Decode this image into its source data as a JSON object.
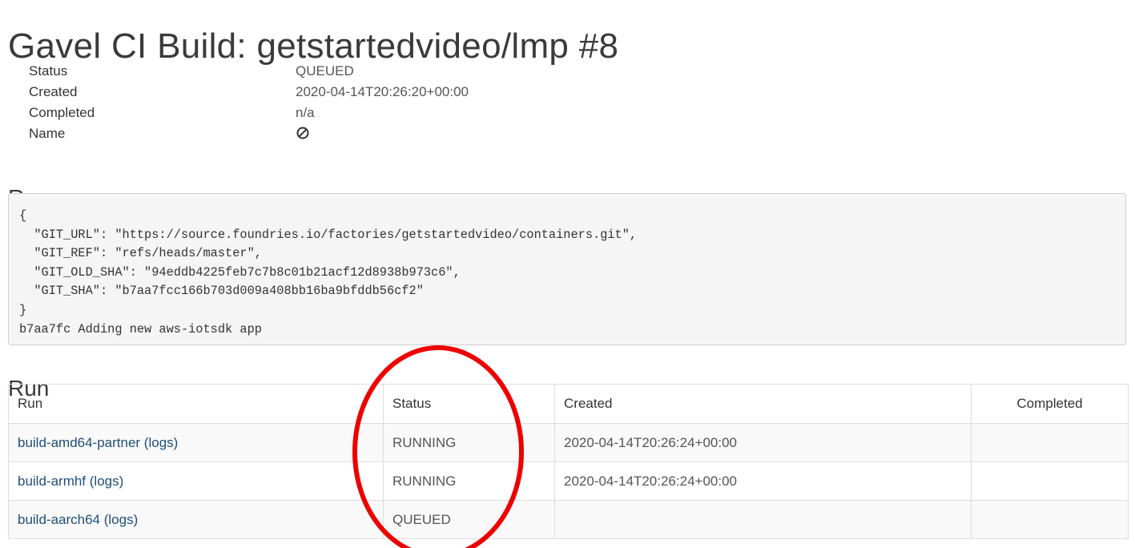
{
  "page": {
    "title": "Gavel CI Build: getstartedvideo/lmp #8"
  },
  "meta": {
    "status_label": "Status",
    "status_value": "QUEUED",
    "created_label": "Created",
    "created_value": "2020-04-14T20:26:20+00:00",
    "completed_label": "Completed",
    "completed_value": "n/a",
    "name_label": "Name",
    "name_icon": "not-available-icon"
  },
  "reason": {
    "heading": "Reason",
    "text": "{\n  \"GIT_URL\": \"https://source.foundries.io/factories/getstartedvideo/containers.git\",\n  \"GIT_REF\": \"refs/heads/master\",\n  \"GIT_OLD_SHA\": \"94eddb4225feb7c7b8c01b21acf12d8938b973c6\",\n  \"GIT_SHA\": \"b7aa7fcc166b703d009a408bb16ba9bfddb56cf2\"\n}\nb7aa7fc Adding new aws-iotsdk app"
  },
  "run": {
    "heading": "Run",
    "columns": [
      "Run",
      "Status",
      "Created",
      "Completed"
    ],
    "rows": [
      {
        "run": "build-amd64-partner (logs)",
        "status": "RUNNING",
        "created": "2020-04-14T20:26:24+00:00",
        "completed": ""
      },
      {
        "run": "build-armhf (logs)",
        "status": "RUNNING",
        "created": "2020-04-14T20:26:24+00:00",
        "completed": ""
      },
      {
        "run": "build-aarch64 (logs)",
        "status": "QUEUED",
        "created": "",
        "completed": ""
      }
    ]
  },
  "colors": {
    "link": "#1f4e79",
    "annotation": "#ee0000",
    "code_background": "#f5f5f5"
  }
}
